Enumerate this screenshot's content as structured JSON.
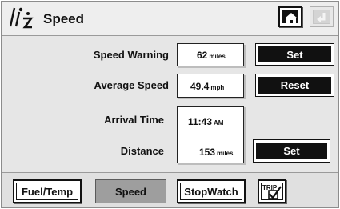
{
  "header": {
    "title": "Speed",
    "logo_icon": "trip-info-icon",
    "home_icon": "home-icon",
    "back_icon": "back-arrow-icon"
  },
  "rows": {
    "speed_warning": {
      "label": "Speed Warning",
      "value": "62",
      "unit": "miles",
      "action": "Set"
    },
    "average_speed": {
      "label": "Average Speed",
      "value": "49.4",
      "unit": "mph",
      "action": "Reset"
    },
    "arrival_time": {
      "label": "Arrival Time",
      "value": "11:43",
      "unit": "AM"
    },
    "distance": {
      "label": "Distance",
      "value": "153",
      "unit": "miles",
      "action": "Set"
    }
  },
  "tabs": [
    {
      "label": "Fuel/Temp",
      "active": false
    },
    {
      "label": "Speed",
      "active": true
    },
    {
      "label": "StopWatch",
      "active": false
    },
    {
      "label": "TRIP",
      "icon": "trip-check-icon",
      "active": false
    }
  ],
  "colors": {
    "background": "#e6e6e6",
    "button": "#111111",
    "active_tab": "#9e9e9e"
  }
}
